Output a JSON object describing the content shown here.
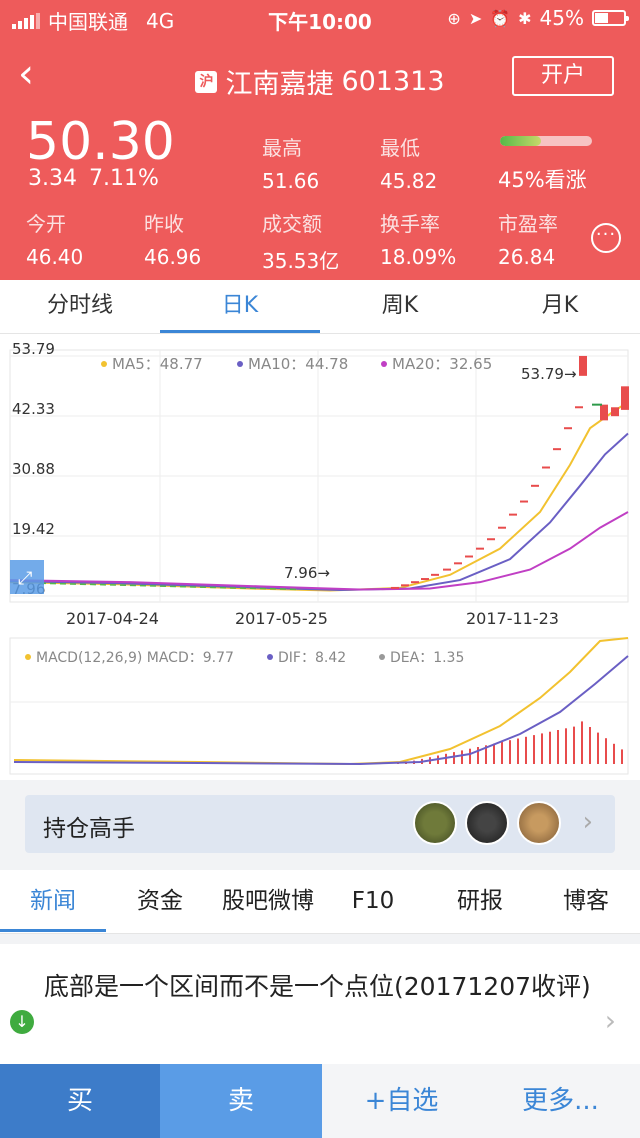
{
  "status": {
    "carrier": "中国联通",
    "network": "4G",
    "time": "下午10:00",
    "battery": "45%",
    "battery_level": 0.45
  },
  "header": {
    "market_badge": "沪",
    "name": "江南嘉捷",
    "code": "601313",
    "open_account": "开户",
    "back_icon": "chevron-left-icon",
    "bg_color": "#ee5b5b"
  },
  "quote": {
    "price": "50.30",
    "change": "3.34",
    "change_pct": "7.11%",
    "high_label": "最高",
    "high": "51.66",
    "low_label": "最低",
    "low": "45.82",
    "sentiment": "45%看涨",
    "sentiment_level": 0.45,
    "open_label": "今开",
    "open": "46.40",
    "prev_close_label": "昨收",
    "prev_close": "46.96",
    "turnover_label": "成交额",
    "turnover": "35.53亿",
    "turnover_rate_label": "换手率",
    "turnover_rate": "18.09%",
    "pe_label": "市盈率",
    "pe": "26.84"
  },
  "chart_tabs": [
    "分时线",
    "日K",
    "周K",
    "月K"
  ],
  "chart_tabs_active": 1,
  "chart_data": {
    "type": "line",
    "y_ticks": [
      "53.79",
      "42.33",
      "30.88",
      "19.42",
      "7.96"
    ],
    "ylim": [
      7.96,
      53.79
    ],
    "x_ticks": [
      "2017-04-24",
      "2017-05-25",
      "2017-11-23"
    ],
    "legend": [
      {
        "name": "MA5",
        "value": "MA5：48.77",
        "color": "#f2c230"
      },
      {
        "name": "MA10",
        "value": "MA10：44.78",
        "color": "#6a5fc4"
      },
      {
        "name": "MA20",
        "value": "MA20：32.65",
        "color": "#c03fc4"
      }
    ],
    "max_marker": "53.79→",
    "min_marker": "7.96→",
    "macd_legend": [
      {
        "label": "MACD(12,26,9) MACD：9.77",
        "color": "#f2c230"
      },
      {
        "label": "DIF：8.42",
        "color": "#6a5fc4"
      },
      {
        "label": "DEA：1.35",
        "color": "#999999"
      }
    ]
  },
  "holders": {
    "label": "持仓高手",
    "avatars": [
      "avatar-1",
      "avatar-2",
      "avatar-3"
    ]
  },
  "news_tabs": [
    "新闻",
    "资金",
    "股吧微博",
    "F10",
    "研报",
    "博客"
  ],
  "news_tabs_active": 0,
  "news": {
    "headline": "底部是一个区间而不是一个点位(20171207收评)"
  },
  "bottom_bar": {
    "buy": "买",
    "sell": "卖",
    "add_watch": "+自选",
    "more": "更多..."
  }
}
